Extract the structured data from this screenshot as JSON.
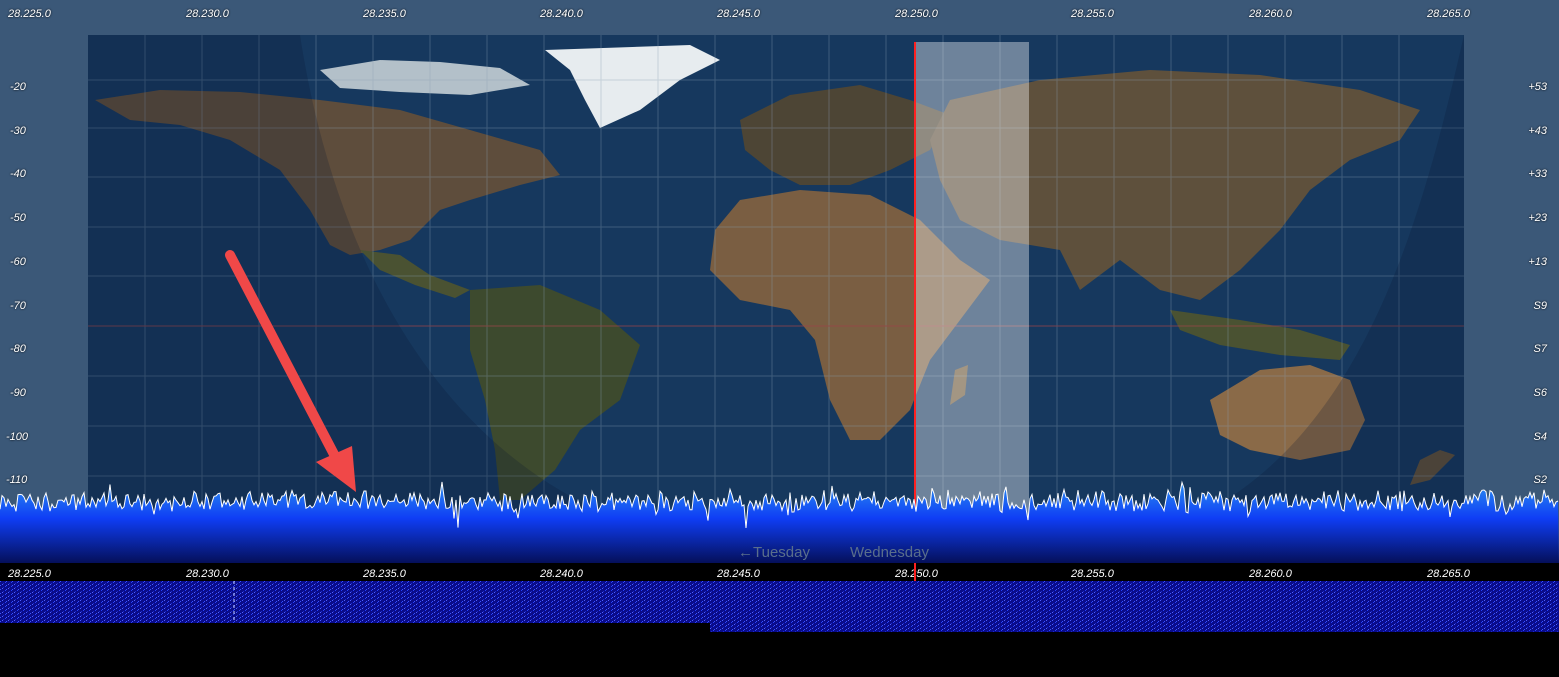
{
  "spectrum": {
    "top_freq_labels": [
      "28.225.0",
      "28.230.0",
      "28.235.0",
      "28.240.0",
      "28.245.0",
      "28.250.0",
      "28.255.0",
      "28.260.0",
      "28.265.0"
    ],
    "db_scale_labels": [
      "-20",
      "-30",
      "-40",
      "-50",
      "-60",
      "-70",
      "-80",
      "-90",
      "-100",
      "-110"
    ],
    "s_meter_labels": [
      "+53",
      "+43",
      "+33",
      "+23",
      "+13",
      "S9",
      "S7",
      "S6",
      "S4",
      "S2"
    ],
    "day_labels": [
      "←Tuesday",
      "Wednesday"
    ],
    "tuned_frequency": "28.250.0",
    "colors": {
      "background": "#3b5878",
      "tuning_line": "#ff2020",
      "noise_trace": "#ffffff",
      "fill": "#0a3cff",
      "annotation_arrow": "#f04848"
    }
  },
  "waterfall_freq_labels": [
    "28.225.0",
    "28.230.0",
    "28.235.0",
    "28.240.0",
    "28.245.0",
    "28.250.0",
    "28.255.0",
    "28.260.0",
    "28.265.0"
  ]
}
